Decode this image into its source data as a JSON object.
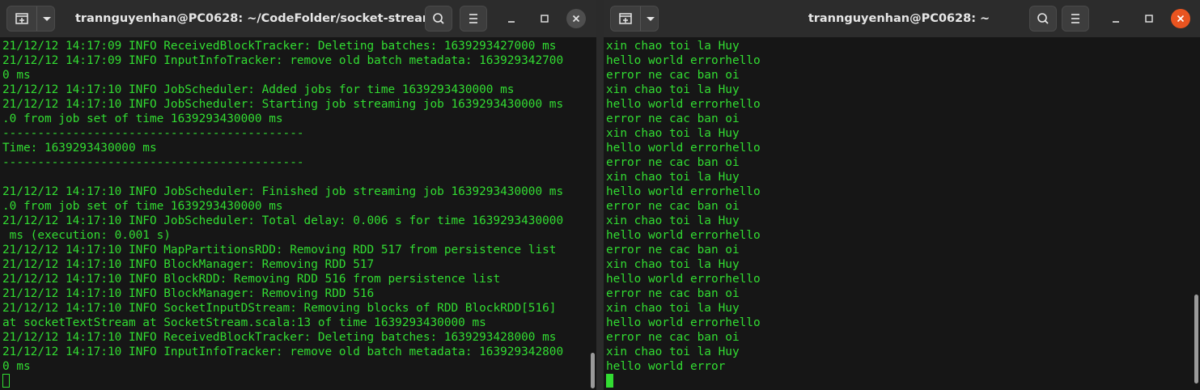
{
  "windows": {
    "left": {
      "title": "trannguyenhan@PC0628: ~/CodeFolder/socket-stream",
      "lines": [
        "21/12/12 14:17:09 INFO ReceivedBlockTracker: Deleting batches: 1639293427000 ms",
        "21/12/12 14:17:09 INFO InputInfoTracker: remove old batch metadata: 163929342700",
        "0 ms",
        "21/12/12 14:17:10 INFO JobScheduler: Added jobs for time 1639293430000 ms",
        "21/12/12 14:17:10 INFO JobScheduler: Starting job streaming job 1639293430000 ms",
        ".0 from job set of time 1639293430000 ms",
        "-------------------------------------------",
        "Time: 1639293430000 ms",
        "-------------------------------------------",
        "",
        "21/12/12 14:17:10 INFO JobScheduler: Finished job streaming job 1639293430000 ms",
        ".0 from job set of time 1639293430000 ms",
        "21/12/12 14:17:10 INFO JobScheduler: Total delay: 0.006 s for time 1639293430000",
        " ms (execution: 0.001 s)",
        "21/12/12 14:17:10 INFO MapPartitionsRDD: Removing RDD 517 from persistence list",
        "21/12/12 14:17:10 INFO BlockManager: Removing RDD 517",
        "21/12/12 14:17:10 INFO BlockRDD: Removing RDD 516 from persistence list",
        "21/12/12 14:17:10 INFO BlockManager: Removing RDD 516",
        "21/12/12 14:17:10 INFO SocketInputDStream: Removing blocks of RDD BlockRDD[516]",
        "at socketTextStream at SocketStream.scala:13 of time 1639293430000 ms",
        "21/12/12 14:17:10 INFO ReceivedBlockTracker: Deleting batches: 1639293428000 ms",
        "21/12/12 14:17:10 INFO InputInfoTracker: remove old batch metadata: 163929342800",
        "0 ms",
        ""
      ],
      "scroll_position": 0.97
    },
    "right": {
      "title": "trannguyenhan@PC0628: ~",
      "lines": [
        "xin chao toi la Huy",
        "hello world errorhello",
        "error ne cac ban oi",
        "xin chao toi la Huy",
        "hello world errorhello",
        "error ne cac ban oi",
        "xin chao toi la Huy",
        "hello world errorhello",
        "error ne cac ban oi",
        "xin chao toi la Huy",
        "hello world errorhello",
        "error ne cac ban oi",
        "xin chao toi la Huy",
        "hello world errorhello",
        "error ne cac ban oi",
        "xin chao toi la Huy",
        "hello world errorhello",
        "error ne cac ban oi",
        "xin chao toi la Huy",
        "hello world errorhello",
        "error ne cac ban oi",
        "xin chao toi la Huy",
        "hello world error",
        ""
      ],
      "scroll_position": 0.97
    }
  },
  "icons": {
    "new_tab": "new-tab-icon",
    "menu_dropdown": "chevron-down-icon",
    "search": "search-icon",
    "hamburger": "hamburger-menu-icon",
    "minimize": "minimize-icon",
    "maximize": "maximize-icon",
    "close": "close-icon"
  },
  "colors": {
    "terminal_text": "#32dc32",
    "terminal_bg": "#161616",
    "titlebar_bg": "#2c2c2c"
  }
}
